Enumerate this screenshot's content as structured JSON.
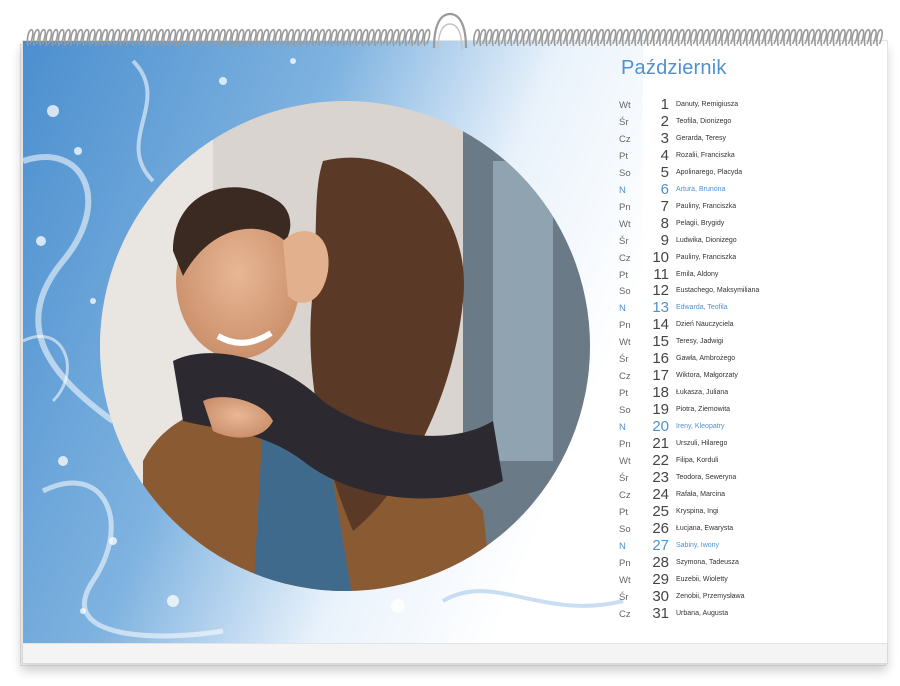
{
  "calendar": {
    "month": "Październik",
    "accent_color": "#4e91cf",
    "photo_description_icon": "couple-photo-icon",
    "days": [
      {
        "dow": "Wt",
        "num": "1",
        "names": "Danuty, Remigiusza",
        "sunday": false
      },
      {
        "dow": "Śr",
        "num": "2",
        "names": "Teofila, Dionizego",
        "sunday": false
      },
      {
        "dow": "Cz",
        "num": "3",
        "names": "Gerarda, Teresy",
        "sunday": false
      },
      {
        "dow": "Pt",
        "num": "4",
        "names": "Rozalii, Franciszka",
        "sunday": false
      },
      {
        "dow": "So",
        "num": "5",
        "names": "Apolinarego, Placyda",
        "sunday": false
      },
      {
        "dow": "N",
        "num": "6",
        "names": "Artura, Brunona",
        "sunday": true
      },
      {
        "dow": "Pn",
        "num": "7",
        "names": "Pauliny, Franciszka",
        "sunday": false
      },
      {
        "dow": "Wt",
        "num": "8",
        "names": "Pelagii, Brygidy",
        "sunday": false
      },
      {
        "dow": "Śr",
        "num": "9",
        "names": "Ludwika, Dionizego",
        "sunday": false
      },
      {
        "dow": "Cz",
        "num": "10",
        "names": "Pauliny, Franciszka",
        "sunday": false
      },
      {
        "dow": "Pt",
        "num": "11",
        "names": "Emila, Aldony",
        "sunday": false
      },
      {
        "dow": "So",
        "num": "12",
        "names": "Eustachego, Maksymiliana",
        "sunday": false
      },
      {
        "dow": "N",
        "num": "13",
        "names": "Edwarda, Teofila",
        "sunday": true
      },
      {
        "dow": "Pn",
        "num": "14",
        "names": "Dzień Nauczyciela",
        "sunday": false
      },
      {
        "dow": "Wt",
        "num": "15",
        "names": "Teresy, Jadwigi",
        "sunday": false
      },
      {
        "dow": "Śr",
        "num": "16",
        "names": "Gawła, Ambrożego",
        "sunday": false
      },
      {
        "dow": "Cz",
        "num": "17",
        "names": "Wiktora, Małgorzaty",
        "sunday": false
      },
      {
        "dow": "Pt",
        "num": "18",
        "names": "Łukasza, Juliana",
        "sunday": false
      },
      {
        "dow": "So",
        "num": "19",
        "names": "Piotra, Ziemowita",
        "sunday": false
      },
      {
        "dow": "N",
        "num": "20",
        "names": "Ireny, Kleopatry",
        "sunday": true
      },
      {
        "dow": "Pn",
        "num": "21",
        "names": "Urszuli, Hilarego",
        "sunday": false
      },
      {
        "dow": "Wt",
        "num": "22",
        "names": "Filipa, Korduli",
        "sunday": false
      },
      {
        "dow": "Śr",
        "num": "23",
        "names": "Teodora, Seweryna",
        "sunday": false
      },
      {
        "dow": "Cz",
        "num": "24",
        "names": "Rafała, Marcina",
        "sunday": false
      },
      {
        "dow": "Pt",
        "num": "25",
        "names": "Kryspina, Ingi",
        "sunday": false
      },
      {
        "dow": "So",
        "num": "26",
        "names": "Łucjana, Ewarysta",
        "sunday": false
      },
      {
        "dow": "N",
        "num": "27",
        "names": "Sabiny, Iwony",
        "sunday": true
      },
      {
        "dow": "Pn",
        "num": "28",
        "names": "Szymona, Tadeusza",
        "sunday": false
      },
      {
        "dow": "Wt",
        "num": "29",
        "names": "Euzebii, Wioletty",
        "sunday": false
      },
      {
        "dow": "Śr",
        "num": "30",
        "names": "Zenobii, Przemysława",
        "sunday": false
      },
      {
        "dow": "Cz",
        "num": "31",
        "names": "Urbana, Augusta",
        "sunday": false
      }
    ]
  }
}
